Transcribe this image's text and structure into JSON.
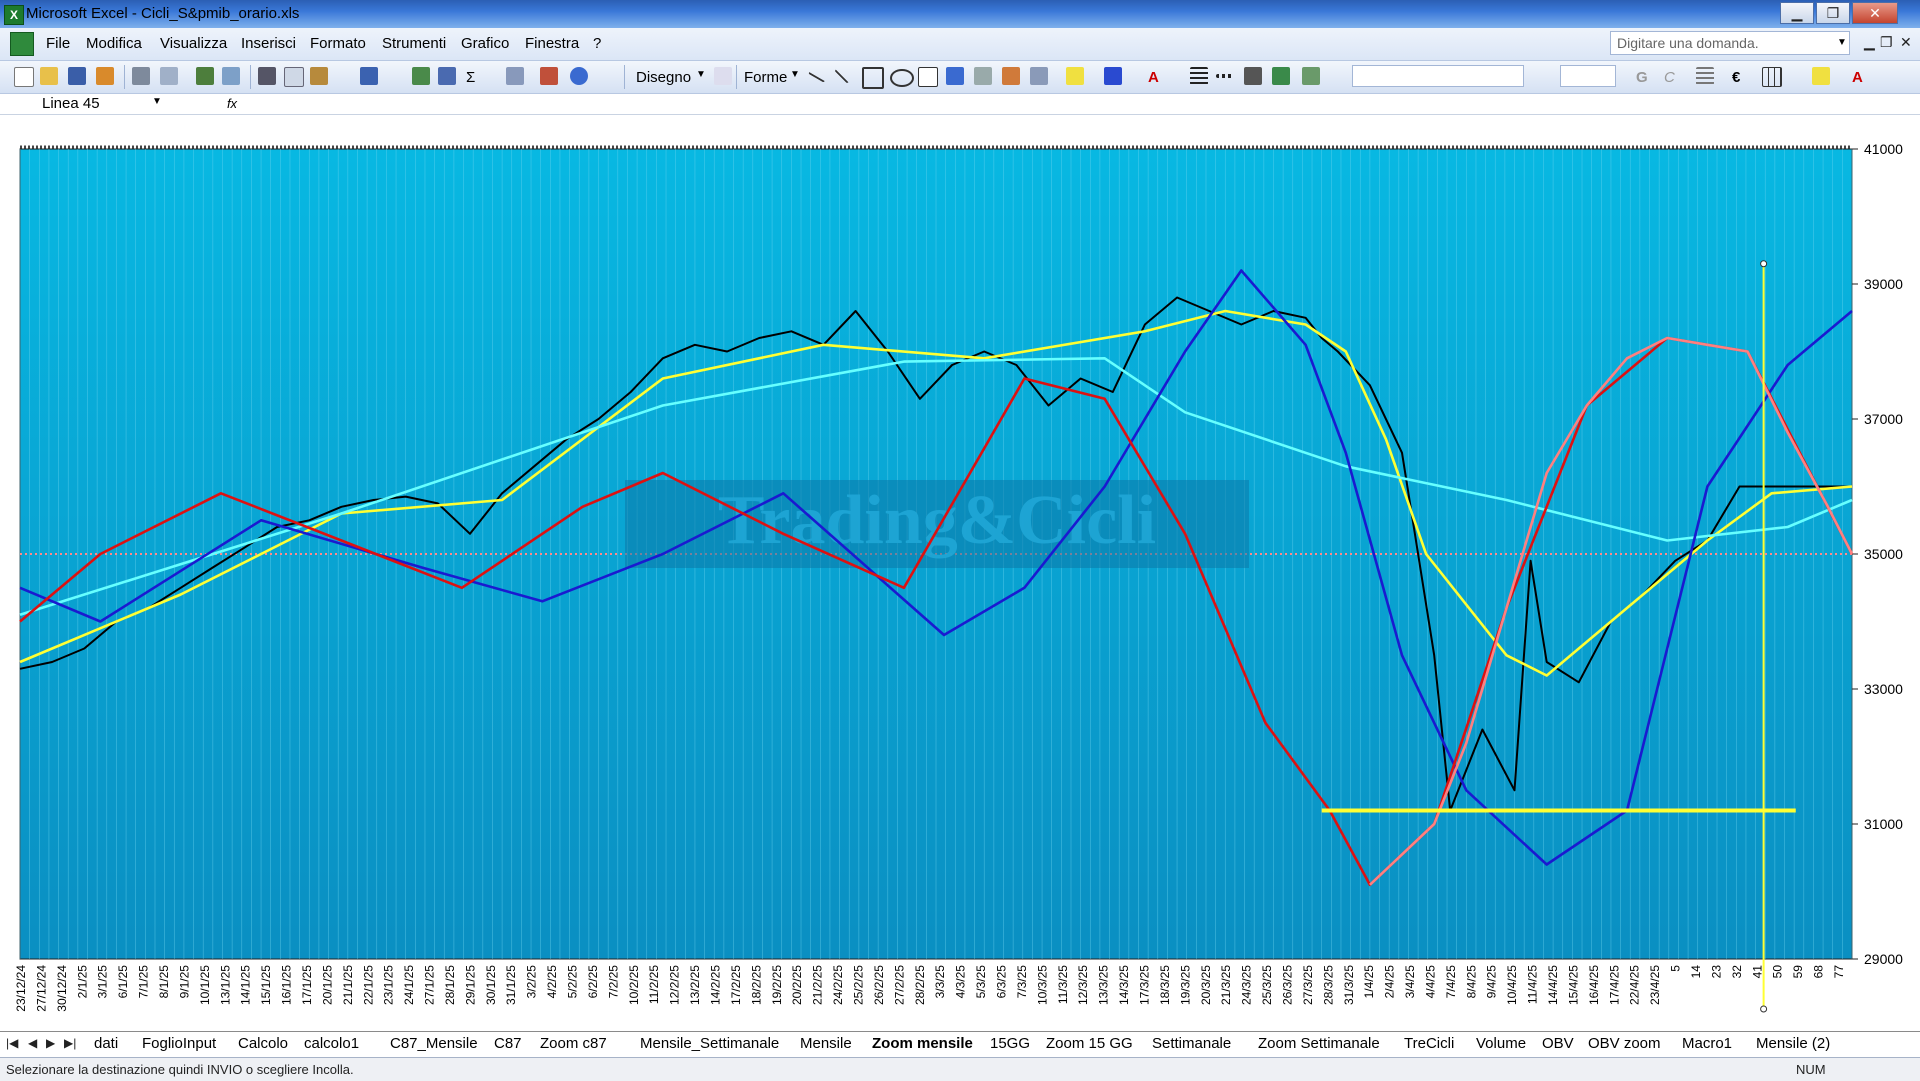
{
  "window": {
    "title": "Microsoft Excel - Cicli_S&pmib_orario.xls",
    "controls": [
      "minimize-icon",
      "restore-icon",
      "close-icon"
    ]
  },
  "menubar": {
    "items": [
      "File",
      "Modifica",
      "Visualizza",
      "Inserisci",
      "Formato",
      "Strumenti",
      "Grafico",
      "Finestra",
      "?"
    ],
    "ask_placeholder": "Digitare una domanda."
  },
  "toolbar": {
    "draw_label": "Disegno",
    "shapes_label": "Forme",
    "icons": [
      "new-icon",
      "open-icon",
      "save-icon",
      "permission-icon",
      "print-icon",
      "print-preview-icon",
      "spelling-icon",
      "research-icon",
      "cut-icon",
      "copy-icon",
      "paste-icon",
      "undo-icon",
      "redo-icon",
      "insert-hyperlink-icon",
      "autosum-icon",
      "sort-icon",
      "chart-wizard-icon",
      "help-icon",
      "select-pointer-icon",
      "line-icon",
      "arrow-icon",
      "rectangle-icon",
      "oval-icon",
      "textbox-icon",
      "wordart-icon",
      "diagram-icon",
      "clipart-icon",
      "picture-icon",
      "fill-color-icon",
      "line-color-icon",
      "font-color-icon",
      "line-style-icon",
      "dash-style-icon",
      "arrow-style-icon",
      "shadow-icon",
      "3d-icon",
      "bold-icon",
      "italic-icon",
      "align-icon",
      "euro-icon",
      "borders-icon",
      "fill-icon",
      "font-color-icon-2"
    ]
  },
  "formula_bar": {
    "name_box": "Linea 45",
    "fx": "fx"
  },
  "chart_data": {
    "type": "line",
    "title": "",
    "watermark": "Trading&Cicli",
    "ylim": [
      29000,
      41000
    ],
    "yticks": [
      29000,
      31000,
      33000,
      35000,
      37000,
      39000,
      41000
    ],
    "ytick_labels": [
      "29000",
      "31000",
      "33000",
      "35000",
      "37000",
      "39000",
      "41000"
    ],
    "background_colors": [
      "#08b8e2",
      "#0a8fc2"
    ],
    "reference_line": {
      "value": 35000,
      "color": "#ff8a8a",
      "style": "dotted"
    },
    "x_labels": [
      "23/12/24",
      "27/12/24",
      "30/12/24",
      "2/1/25",
      "3/1/25",
      "6/1/25",
      "7/1/25",
      "8/1/25",
      "9/1/25",
      "10/1/25",
      "13/1/25",
      "14/1/25",
      "15/1/25",
      "16/1/25",
      "17/1/25",
      "20/1/25",
      "21/1/25",
      "22/1/25",
      "23/1/25",
      "24/1/25",
      "27/1/25",
      "28/1/25",
      "29/1/25",
      "30/1/25",
      "31/1/25",
      "3/2/25",
      "4/2/25",
      "5/2/25",
      "6/2/25",
      "7/2/25",
      "10/2/25",
      "11/2/25",
      "12/2/25",
      "13/2/25",
      "14/2/25",
      "17/2/25",
      "18/2/25",
      "19/2/25",
      "20/2/25",
      "21/2/25",
      "24/2/25",
      "25/2/25",
      "26/2/25",
      "27/2/25",
      "28/2/25",
      "3/3/25",
      "4/3/25",
      "5/3/25",
      "6/3/25",
      "7/3/25",
      "10/3/25",
      "11/3/25",
      "12/3/25",
      "13/3/25",
      "14/3/25",
      "17/3/25",
      "18/3/25",
      "19/3/25",
      "20/3/25",
      "21/3/25",
      "24/3/25",
      "25/3/25",
      "26/3/25",
      "27/3/25",
      "28/3/25",
      "31/3/25",
      "1/4/25",
      "2/4/25",
      "3/4/25",
      "4/4/25",
      "7/4/25",
      "8/4/25",
      "9/4/25",
      "10/4/25",
      "11/4/25",
      "14/4/25",
      "15/4/25",
      "16/4/25",
      "17/4/25",
      "22/4/25",
      "23/4/25",
      "5",
      "14",
      "23",
      "32",
      "41",
      "50",
      "59",
      "68",
      "77"
    ],
    "series": [
      {
        "color": "#000000",
        "points": [
          [
            0,
            33300
          ],
          [
            4,
            33400
          ],
          [
            8,
            33600
          ],
          [
            12,
            34000
          ],
          [
            16,
            34200
          ],
          [
            20,
            34500
          ],
          [
            24,
            34800
          ],
          [
            28,
            35100
          ],
          [
            32,
            35400
          ],
          [
            36,
            35500
          ],
          [
            40,
            35700
          ],
          [
            44,
            35800
          ],
          [
            48,
            35850
          ],
          [
            52,
            35750
          ],
          [
            56,
            35300
          ],
          [
            60,
            35900
          ],
          [
            64,
            36300
          ],
          [
            68,
            36700
          ],
          [
            72,
            37000
          ],
          [
            76,
            37400
          ],
          [
            80,
            37900
          ],
          [
            84,
            38100
          ],
          [
            88,
            38000
          ],
          [
            92,
            38200
          ],
          [
            96,
            38300
          ],
          [
            100,
            38100
          ],
          [
            104,
            38600
          ],
          [
            108,
            38000
          ],
          [
            112,
            37300
          ],
          [
            116,
            37800
          ],
          [
            120,
            38000
          ],
          [
            124,
            37800
          ],
          [
            128,
            37200
          ],
          [
            132,
            37600
          ],
          [
            136,
            37400
          ],
          [
            140,
            38400
          ],
          [
            144,
            38800
          ],
          [
            148,
            38600
          ],
          [
            152,
            38400
          ],
          [
            156,
            38600
          ],
          [
            160,
            38500
          ],
          [
            162,
            38200
          ],
          [
            164,
            38000
          ],
          [
            168,
            37500
          ],
          [
            172,
            36500
          ],
          [
            176,
            33500
          ],
          [
            178,
            31200
          ],
          [
            182,
            32400
          ],
          [
            186,
            31500
          ],
          [
            188,
            34900
          ],
          [
            190,
            33400
          ],
          [
            194,
            33100
          ],
          [
            198,
            34000
          ],
          [
            202,
            34400
          ],
          [
            206,
            34900
          ],
          [
            210,
            35200
          ],
          [
            214,
            36000
          ],
          [
            218,
            36000
          ],
          [
            228,
            36000
          ]
        ]
      },
      {
        "color": "#ffff33",
        "points": [
          [
            0,
            33400
          ],
          [
            20,
            34400
          ],
          [
            40,
            35600
          ],
          [
            60,
            35800
          ],
          [
            80,
            37600
          ],
          [
            100,
            38100
          ],
          [
            120,
            37900
          ],
          [
            140,
            38300
          ],
          [
            150,
            38600
          ],
          [
            160,
            38400
          ],
          [
            165,
            38000
          ],
          [
            170,
            36700
          ],
          [
            175,
            35000
          ],
          [
            185,
            33500
          ],
          [
            190,
            33200
          ],
          [
            200,
            34200
          ],
          [
            210,
            35200
          ],
          [
            218,
            35900
          ],
          [
            228,
            36000
          ]
        ]
      },
      {
        "color": "#66ffff",
        "points": [
          [
            0,
            34100
          ],
          [
            40,
            35600
          ],
          [
            80,
            37200
          ],
          [
            110,
            37850
          ],
          [
            135,
            37900
          ],
          [
            145,
            37100
          ],
          [
            165,
            36300
          ],
          [
            185,
            35800
          ],
          [
            205,
            35200
          ],
          [
            220,
            35400
          ],
          [
            228,
            35800
          ]
        ]
      },
      {
        "color": "#1a1ad0",
        "points": [
          [
            0,
            34500
          ],
          [
            10,
            34000
          ],
          [
            30,
            35500
          ],
          [
            50,
            34800
          ],
          [
            65,
            34300
          ],
          [
            80,
            35000
          ],
          [
            95,
            35900
          ],
          [
            115,
            33800
          ],
          [
            125,
            34500
          ],
          [
            135,
            36000
          ],
          [
            145,
            38000
          ],
          [
            152,
            39200
          ],
          [
            160,
            38100
          ],
          [
            165,
            36500
          ],
          [
            172,
            33500
          ],
          [
            180,
            31500
          ],
          [
            190,
            30400
          ],
          [
            200,
            31200
          ],
          [
            210,
            36000
          ],
          [
            220,
            37800
          ],
          [
            228,
            38600
          ]
        ]
      },
      {
        "color": "#dd1111",
        "points": [
          [
            0,
            34000
          ],
          [
            10,
            35000
          ],
          [
            25,
            35900
          ],
          [
            40,
            35200
          ],
          [
            55,
            34500
          ],
          [
            70,
            35700
          ],
          [
            80,
            36200
          ],
          [
            95,
            35300
          ],
          [
            110,
            34500
          ],
          [
            125,
            37600
          ],
          [
            135,
            37300
          ],
          [
            145,
            35300
          ],
          [
            155,
            32500
          ],
          [
            163,
            31200
          ],
          [
            168,
            30100
          ],
          [
            176,
            31000
          ],
          [
            185,
            34200
          ],
          [
            195,
            37200
          ],
          [
            205,
            38200
          ],
          [
            215,
            38000
          ],
          [
            228,
            35000
          ]
        ]
      },
      {
        "color": "#ff8080",
        "points": [
          [
            168,
            30100
          ],
          [
            176,
            31000
          ],
          [
            180,
            32200
          ],
          [
            185,
            34200
          ],
          [
            190,
            36200
          ],
          [
            195,
            37200
          ],
          [
            200,
            37900
          ],
          [
            205,
            38200
          ],
          [
            210,
            38100
          ],
          [
            215,
            38000
          ],
          [
            220,
            36800
          ],
          [
            225,
            35700
          ],
          [
            228,
            35000
          ]
        ]
      }
    ],
    "annotations": [
      {
        "type": "horizontal-line",
        "color": "#ffff33",
        "y": 31200,
        "x_range": [
          162,
          221
        ]
      },
      {
        "type": "vertical-line",
        "color": "#ffff33",
        "x": 217,
        "y_range": [
          29000,
          39300
        ]
      }
    ]
  },
  "sheet_tabs": {
    "items": [
      "dati",
      "FoglioInput",
      "Calcolo",
      "calcolo1",
      "C87_Mensile",
      "C87",
      "Zoom c87",
      "Mensile_Settimanale",
      "Mensile",
      "Zoom mensile",
      "15GG",
      "Zoom 15 GG",
      "Settimanale",
      "Zoom Settimanale",
      "TreCicli",
      "Volume",
      "OBV",
      "OBV zoom",
      "Macro1",
      "Mensile (2)"
    ],
    "active": "Zoom mensile"
  },
  "status": {
    "message": "Selezionare la destinazione quindi INVIO o scegliere Incolla.",
    "indicator": "NUM"
  }
}
